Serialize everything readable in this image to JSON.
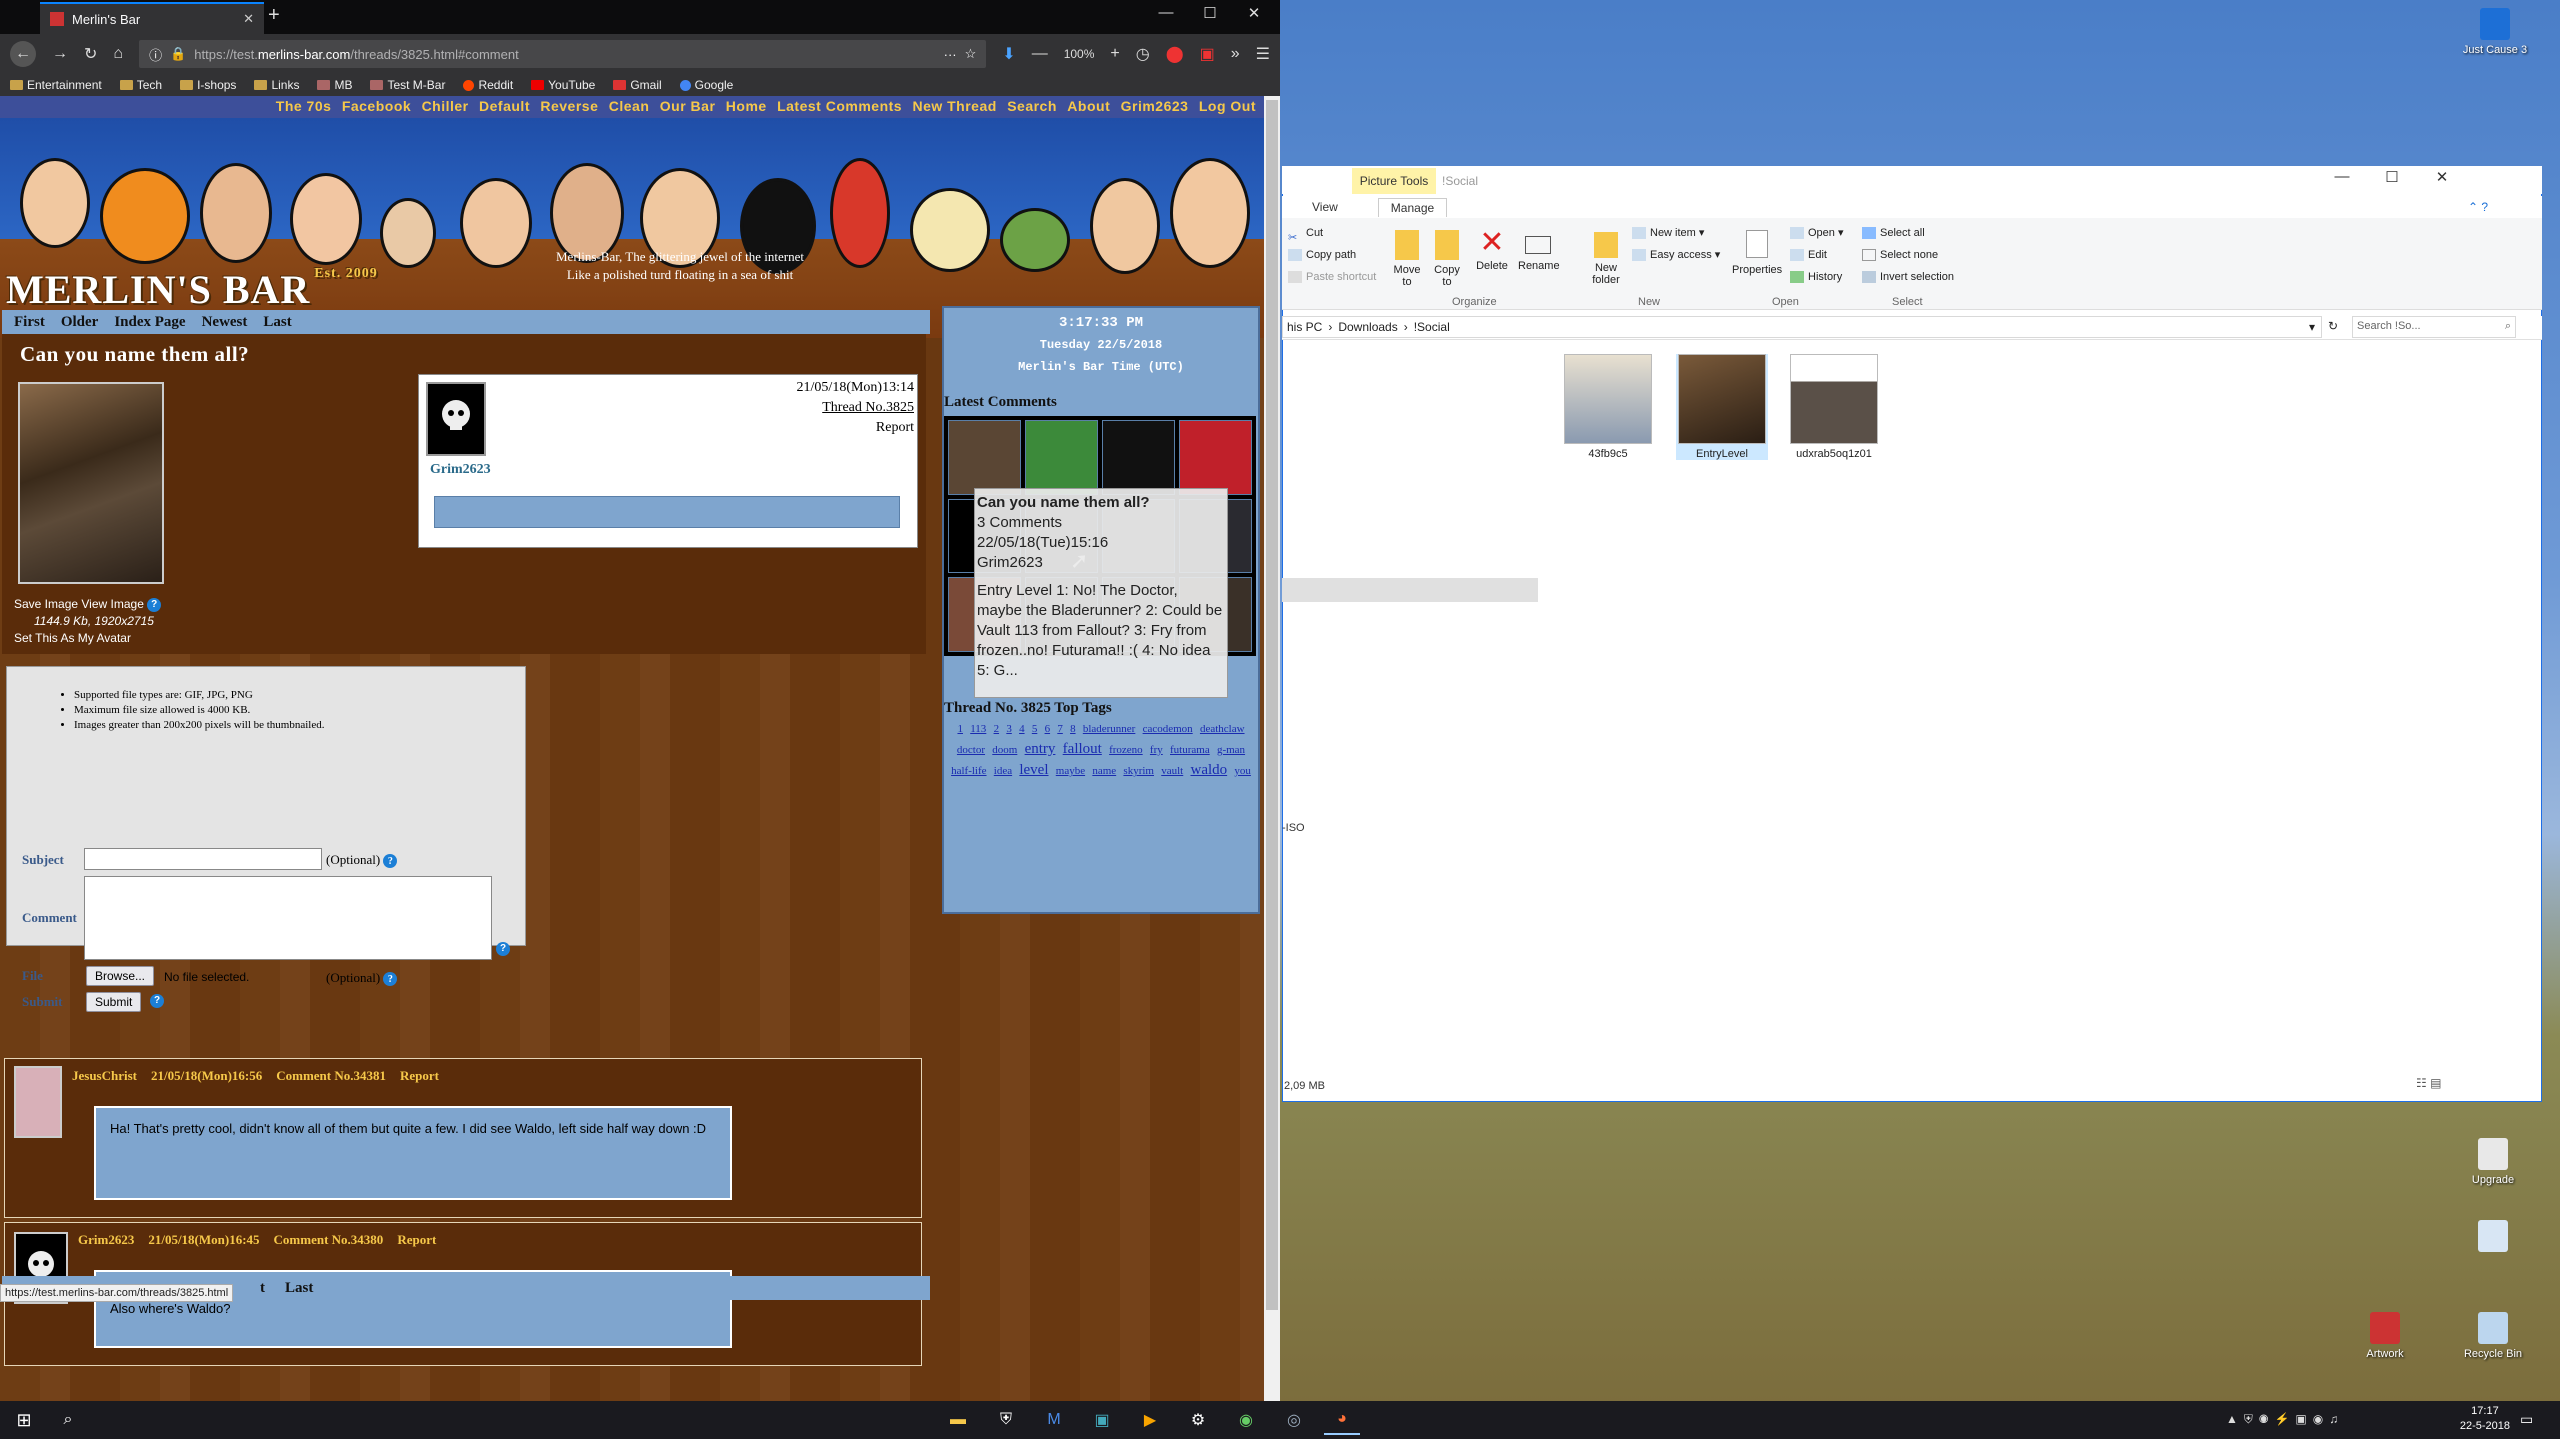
{
  "browser": {
    "tab_title": "Merlin's Bar",
    "url_prefix": "https://test.",
    "url_host": "merlins-bar.com",
    "url_path": "/threads/3825.html#comment",
    "zoom": "100%",
    "bookmarks": [
      "Entertainment",
      "Tech",
      "I-shops",
      "Links",
      "MB",
      "Test M-Bar",
      "Reddit",
      "YouTube",
      "Gmail",
      "Google"
    ]
  },
  "site": {
    "nav": [
      "The 70s",
      "Facebook",
      "Chiller",
      "Default",
      "Reverse",
      "Clean",
      "Our Bar",
      "Home",
      "Latest Comments",
      "New Thread",
      "Search",
      "About",
      "Grim2623",
      "Log Out"
    ],
    "logo": "MERLIN'S BAR",
    "logo_est": "Est. 2009",
    "tagline_1": "Merlins-Bar, The glittering jewel of the internet",
    "tagline_2": "Like a polished turd floating in a sea of shit",
    "paging": [
      "First",
      "Older",
      "Index Page",
      "Newest",
      "Last"
    ],
    "thread": {
      "title": "Can you name them all?",
      "save_image": "Save Image",
      "view_image": "View Image",
      "image_info": "1144.9 Kb, 1920x2715",
      "set_avatar": "Set This As My Avatar",
      "op_name": "Grim2623",
      "date": "21/05/18(Mon)13:14",
      "thread_no": "Thread No.3825",
      "report": "Report"
    },
    "form": {
      "rules": [
        "Supported file types are: GIF, JPG, PNG",
        "Maximum file size allowed is 4000 KB.",
        "Images greater than 200x200 pixels will be thumbnailed."
      ],
      "subject_label": "Subject",
      "comment_label": "Comment",
      "file_label": "File",
      "submit_label": "Submit",
      "optional": "(Optional)",
      "browse": "Browse...",
      "no_file": "No file selected.",
      "submit_button": "Submit"
    },
    "comments": [
      {
        "user": "JesusChrist",
        "date": "21/05/18(Mon)16:56",
        "no": "Comment No.34381",
        "report": "Report",
        "text": "Ha! That's pretty cool, didn't know all of them but quite a few. I did see Waldo, left side half way down :D"
      },
      {
        "user": "Grim2623",
        "date": "21/05/18(Mon)16:45",
        "no": "Comment No.34380",
        "report": "Report",
        "text": "Also where's Waldo?"
      }
    ],
    "bottom_last": "Last",
    "bottom_partial": "t",
    "status_url": "https://test.merlins-bar.com/threads/3825.html",
    "sidebar": {
      "time": "3:17:33 PM",
      "date": "Tuesday 22/5/2018",
      "tz": "Merlin's Bar Time (UTC)",
      "latest_heading": "Latest Comments",
      "tooltip": {
        "title": "Can you name them all?",
        "count": "3 Comments",
        "date": "22/05/18(Tue)15:16",
        "user": "Grim2623",
        "preview": "Entry Level 1: No! The Doctor, maybe the Bladerunner? 2: Could be Vault 113 from Fallout? 3: Fry from frozen..no! Futurama!! :( 4: No idea 5: G..."
      },
      "tags_heading": "Thread No. 3825 Top Tags",
      "tags": [
        "1",
        "113",
        "2",
        "3",
        "4",
        "5",
        "6",
        "7",
        "8",
        "bladerunner",
        "cacodemon",
        "deathclaw",
        "doctor",
        "doom",
        "entry",
        "fallout",
        "frozeno",
        "fry",
        "futurama",
        "g-man",
        "half-life",
        "idea",
        "level",
        "maybe",
        "name",
        "skyrim",
        "vault",
        "waldo",
        "you"
      ]
    }
  },
  "explorer": {
    "picture_tools": "Picture Tools",
    "title": "!Social",
    "tabs": [
      "View",
      "Manage"
    ],
    "ribbon": {
      "cut": "Cut",
      "copy_path": "Copy path",
      "paste_shortcut": "Paste shortcut",
      "move_to": "Move to",
      "copy_to": "Copy to",
      "delete": "Delete",
      "rename": "Rename",
      "new_folder": "New folder",
      "new_item": "New item",
      "easy_access": "Easy access",
      "properties": "Properties",
      "open": "Open",
      "edit": "Edit",
      "history": "History",
      "select_all": "Select all",
      "select_none": "Select none",
      "invert_selection": "Invert selection",
      "g_organize": "Organize",
      "g_new": "New",
      "g_open": "Open",
      "g_select": "Select"
    },
    "path": [
      "his PC",
      "Downloads",
      "!Social"
    ],
    "search_placeholder": "Search !So...",
    "files": [
      "43fb9c5",
      "EntryLevel",
      "udxrab5oq1z01"
    ],
    "iso_text": "-ISO",
    "size_text": "2,09 MB"
  },
  "desktop": {
    "icons": [
      "Just Cause 3",
      "Upgrade",
      "Artwork",
      "Recycle Bin"
    ],
    "clock_time": "17:17",
    "clock_date": "22-5-2018"
  }
}
